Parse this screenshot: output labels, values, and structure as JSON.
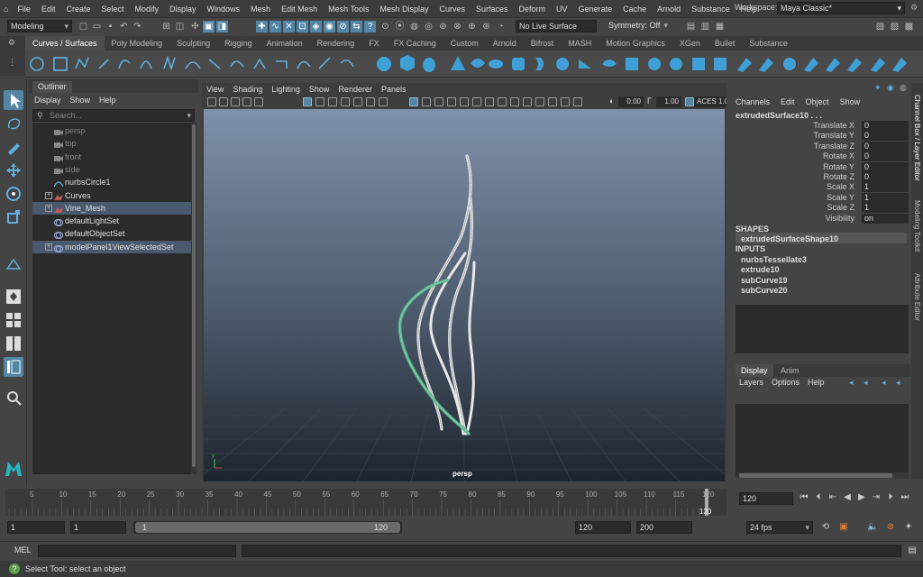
{
  "menubar": {
    "items": [
      "File",
      "Edit",
      "Create",
      "Select",
      "Modify",
      "Display",
      "Windows",
      "Mesh",
      "Edit Mesh",
      "Mesh Tools",
      "Mesh Display",
      "Curves",
      "Surfaces",
      "Deform",
      "UV",
      "Generate",
      "Cache",
      "Arnold",
      "Substance",
      "Help"
    ],
    "workspace_label": "Workspace:",
    "workspace_value": "Maya Classic*"
  },
  "statusline": {
    "menuset": "Modeling",
    "live_surface": "No Live Surface",
    "symmetry": "Symmetry: Off"
  },
  "shelf": {
    "tabs": [
      "Curves / Surfaces",
      "Poly Modeling",
      "Sculpting",
      "Rigging",
      "Animation",
      "Rendering",
      "FX",
      "FX Caching",
      "Custom",
      "Arnold",
      "Bifrost",
      "MASH",
      "Motion Graphics",
      "XGen",
      "Bullet",
      "Substance"
    ],
    "active_tab": 0
  },
  "outliner": {
    "title": "Outliner",
    "menu": [
      "Display",
      "Show",
      "Help"
    ],
    "search_placeholder": "Search...",
    "items": [
      {
        "label": "persp",
        "dim": true,
        "icon": "camera"
      },
      {
        "label": "top",
        "dim": true,
        "icon": "camera"
      },
      {
        "label": "front",
        "dim": true,
        "icon": "camera"
      },
      {
        "label": "side",
        "dim": true,
        "icon": "camera"
      },
      {
        "label": "nurbsCircle1",
        "dim": false,
        "icon": "curve"
      },
      {
        "label": "Curves",
        "dim": false,
        "icon": "group",
        "expand": true
      },
      {
        "label": "Vine_Mesh",
        "dim": false,
        "icon": "group",
        "expand": true,
        "selected": true
      },
      {
        "label": "defaultLightSet",
        "dim": false,
        "icon": "set"
      },
      {
        "label": "defaultObjectSet",
        "dim": false,
        "icon": "set"
      },
      {
        "label": "modelPanel1ViewSelectedSet",
        "dim": false,
        "icon": "set",
        "expand": true,
        "selected": true
      }
    ]
  },
  "viewport": {
    "menu": [
      "View",
      "Shading",
      "Lighting",
      "Show",
      "Renderer",
      "Panels"
    ],
    "exposure": "0.00",
    "gamma": "1.00",
    "colorspace": "ACES 1.0",
    "camera_label": "persp"
  },
  "channelbox": {
    "menu": [
      "Channels",
      "Edit",
      "Object",
      "Show"
    ],
    "object_name": "extrudedSurface10 . . .",
    "attributes": [
      {
        "label": "Translate X",
        "value": "0"
      },
      {
        "label": "Translate Y",
        "value": "0"
      },
      {
        "label": "Translate Z",
        "value": "0"
      },
      {
        "label": "Rotate X",
        "value": "0"
      },
      {
        "label": "Rotate Y",
        "value": "0"
      },
      {
        "label": "Rotate Z",
        "value": "0"
      },
      {
        "label": "Scale X",
        "value": "1"
      },
      {
        "label": "Scale Y",
        "value": "1"
      },
      {
        "label": "Scale Z",
        "value": "1"
      },
      {
        "label": "Visibility",
        "value": "on"
      }
    ],
    "shapes_heading": "SHAPES",
    "shape": "extrudedSurfaceShape10",
    "inputs_heading": "INPUTS",
    "inputs": [
      "nurbsTessellate3",
      "extrude10",
      "subCurve19",
      "subCurve20"
    ]
  },
  "layers": {
    "tabs": [
      "Display",
      "Anim"
    ],
    "menu": [
      "Layers",
      "Options",
      "Help"
    ]
  },
  "sidetabs": [
    "Channel Box / Layer Editor",
    "Modeling Toolkit",
    "Attribute Editor"
  ],
  "timeslider": {
    "ticks": [
      "5",
      "10",
      "15",
      "20",
      "25",
      "30",
      "35",
      "40",
      "45",
      "50",
      "55",
      "60",
      "65",
      "70",
      "75",
      "80",
      "85",
      "90",
      "95",
      "100",
      "105",
      "110",
      "115",
      "120"
    ],
    "current_frame": "120",
    "playhead": "120"
  },
  "rangeslider": {
    "start_field": "1",
    "playback_start": "1",
    "range_start": "1",
    "range_end": "120",
    "playback_end": "120",
    "end_field": "200",
    "fps": "24 fps"
  },
  "cmdline": {
    "label": "MEL"
  },
  "helpline": {
    "text": "Select Tool: select an object"
  }
}
